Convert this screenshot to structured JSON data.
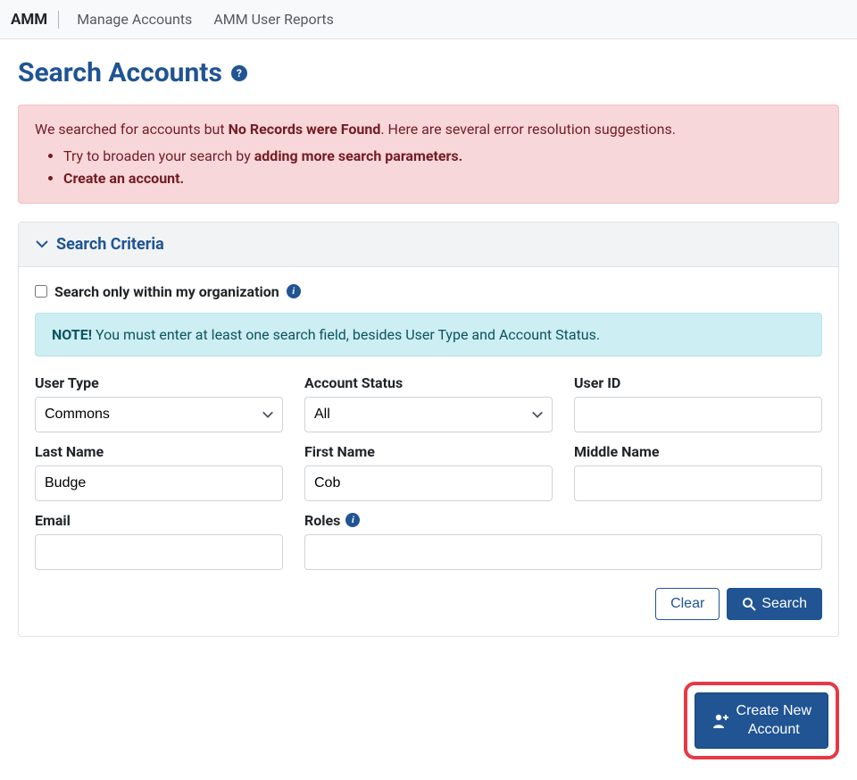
{
  "nav": {
    "brand": "AMM",
    "links": [
      "Manage Accounts",
      "AMM User Reports"
    ]
  },
  "page": {
    "title": "Search Accounts"
  },
  "alert": {
    "pre": "We searched for accounts but ",
    "bold1": "No Records were Found",
    "post1": ". Here are several error resolution suggestions.",
    "item1_pre": "Try to broaden your search by ",
    "item1_bold": "adding more search parameters.",
    "item2_bold": "Create an account."
  },
  "panel": {
    "header": "Search Criteria",
    "orgLabel": "Search only within my organization",
    "note_strong": "NOTE!",
    "note_text": " You must enter at least one search field, besides User Type and Account Status."
  },
  "fields": {
    "userType": {
      "label": "User Type",
      "value": "Commons"
    },
    "accountStatus": {
      "label": "Account Status",
      "value": "All"
    },
    "userId": {
      "label": "User ID",
      "value": ""
    },
    "lastName": {
      "label": "Last Name",
      "value": "Budge"
    },
    "firstName": {
      "label": "First Name",
      "value": "Cob"
    },
    "middleName": {
      "label": "Middle Name",
      "value": ""
    },
    "email": {
      "label": "Email",
      "value": ""
    },
    "roles": {
      "label": "Roles",
      "value": ""
    }
  },
  "buttons": {
    "clear": "Clear",
    "search": "Search",
    "createNew": "Create New\nAccount"
  }
}
